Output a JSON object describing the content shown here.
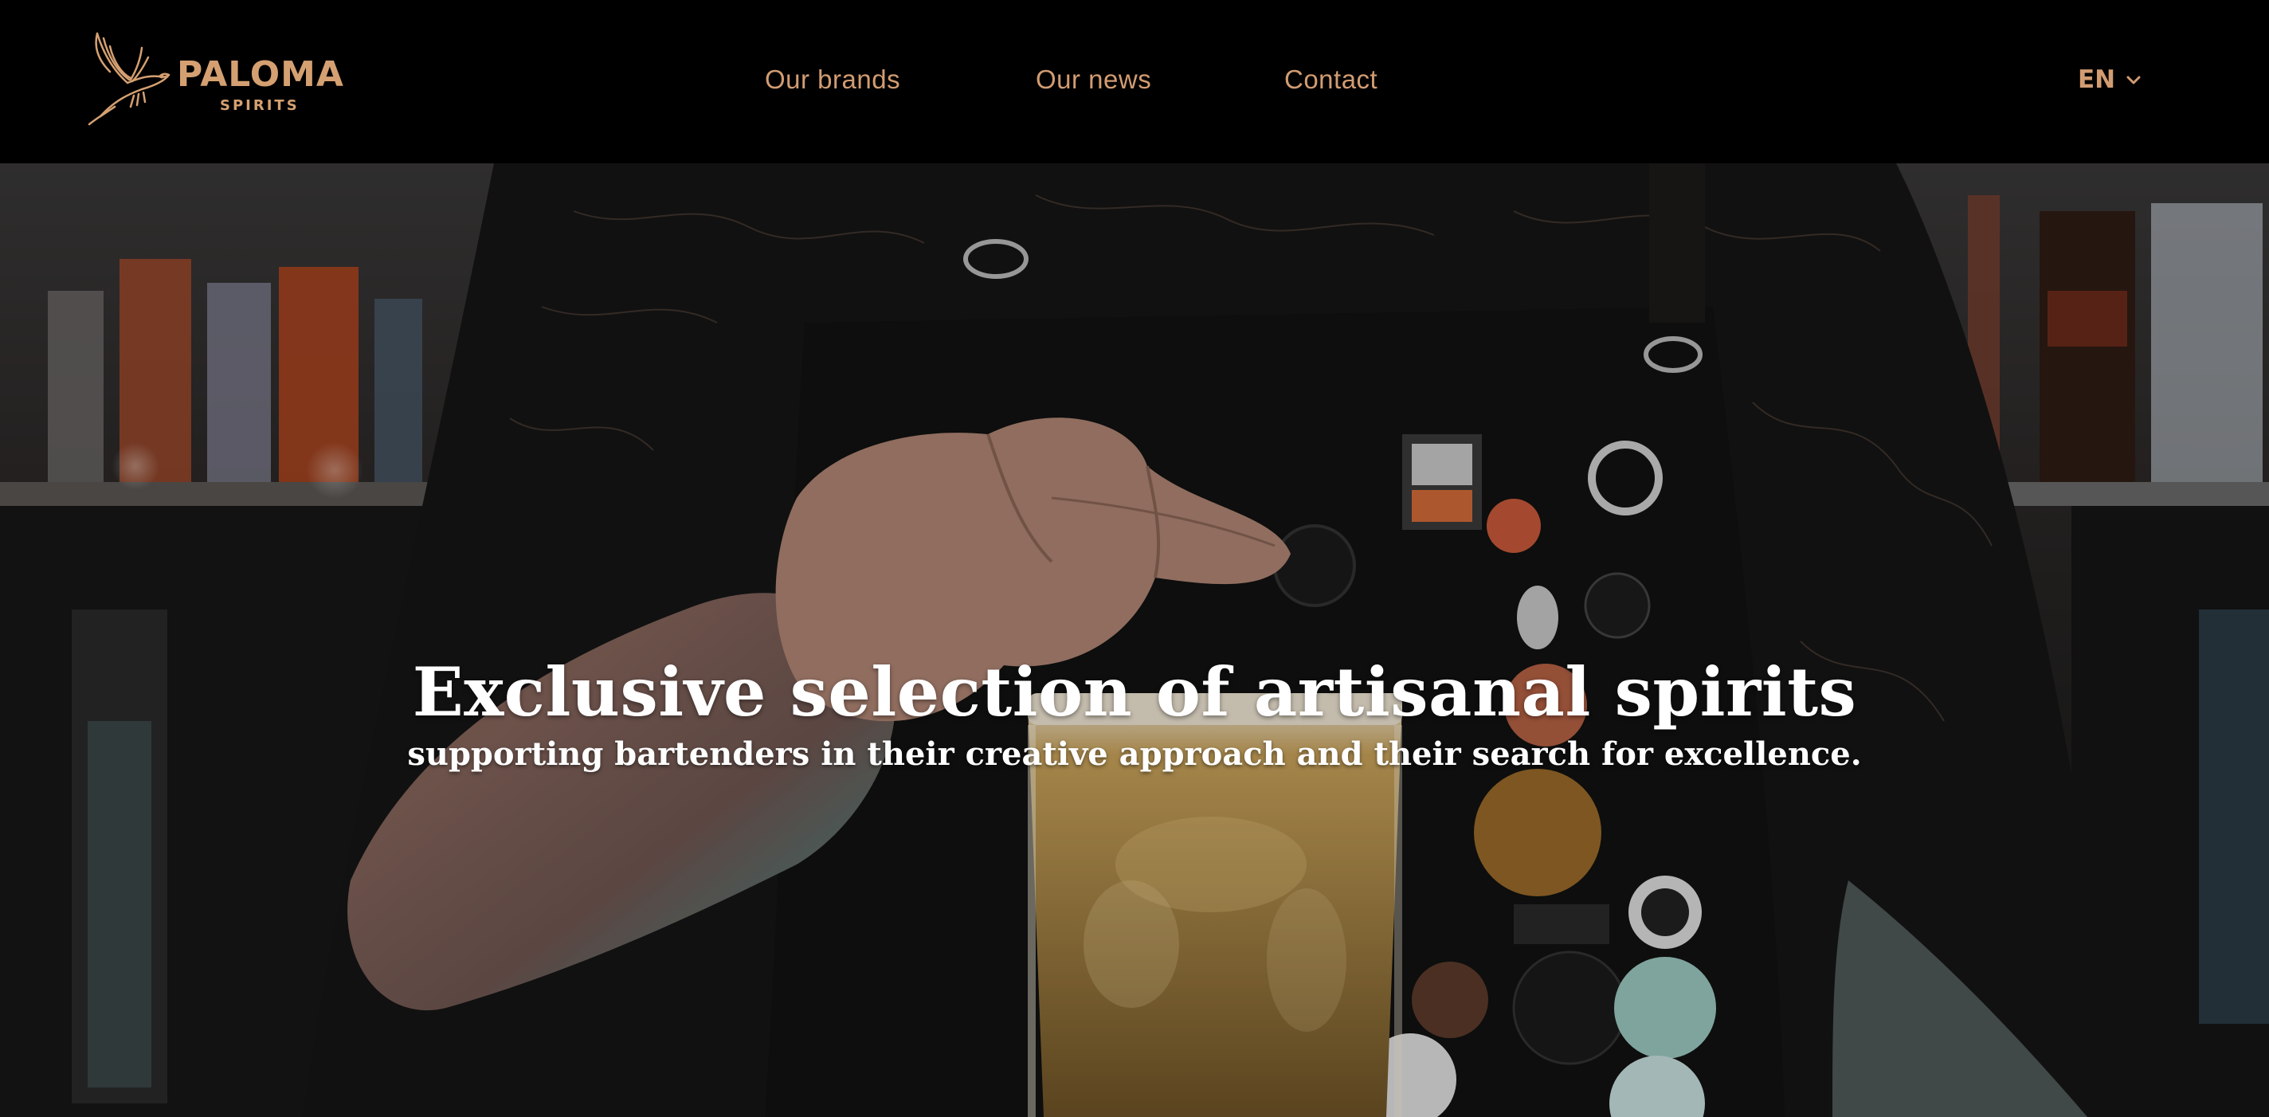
{
  "header": {
    "logo": {
      "name": "PALOMA",
      "tagline": "SPIRITS"
    },
    "nav": [
      {
        "label": "Our brands"
      },
      {
        "label": "Our news"
      },
      {
        "label": "Contact"
      }
    ],
    "language": {
      "selected": "EN",
      "icon": "chevron-down-icon"
    }
  },
  "hero": {
    "title": "Exclusive selection of artisanal spirits",
    "subtitle": "supporting bartenders in their creative approach and their search for excellence."
  },
  "colors": {
    "accent": "#d29c72",
    "header_bg": "#000000",
    "hero_text": "#ffffff"
  }
}
